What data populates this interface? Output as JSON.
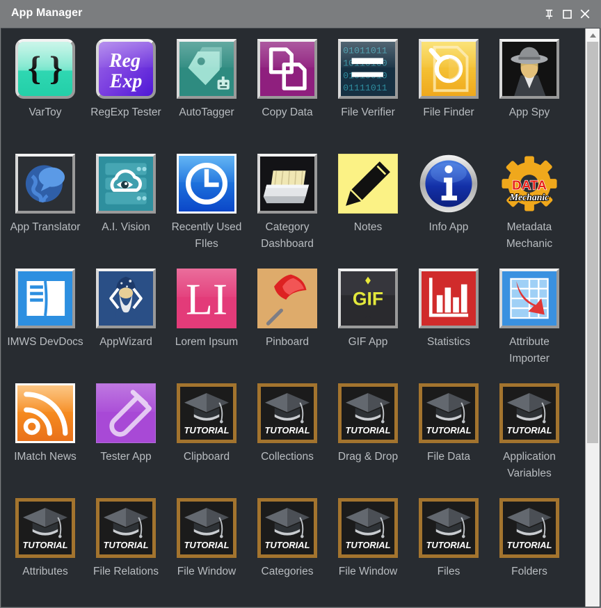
{
  "window": {
    "title": "App Manager",
    "titlebar_bg": "#7b7d7f",
    "client_bg": "#282c31",
    "label_color": "#b9bdc1",
    "buttons": [
      {
        "name": "pin-icon",
        "label": "Pin"
      },
      {
        "name": "maximize-icon",
        "label": "Maximize"
      },
      {
        "name": "close-icon",
        "label": "Close"
      }
    ]
  },
  "scrollbar": {
    "up_arrow": "▲",
    "thumb_position_percent": 0,
    "thumb_size_percent": 71
  },
  "apps": [
    {
      "name": "VarToy",
      "icon": "vartoy-icon"
    },
    {
      "name": "RegExp Tester",
      "icon": "regexp-tester-icon"
    },
    {
      "name": "AutoTagger",
      "icon": "autotagger-icon"
    },
    {
      "name": "Copy Data",
      "icon": "copy-data-icon"
    },
    {
      "name": "File Verifier",
      "icon": "file-verifier-icon"
    },
    {
      "name": "File Finder",
      "icon": "file-finder-icon"
    },
    {
      "name": "App Spy",
      "icon": "app-spy-icon"
    },
    {
      "name": "App Translator",
      "icon": "app-translator-icon"
    },
    {
      "name": "A.I. Vision",
      "icon": "ai-vision-icon"
    },
    {
      "name": "Recently Used FIles",
      "icon": "recently-used-files-icon"
    },
    {
      "name": "Category Dashboard",
      "icon": "category-dashboard-icon"
    },
    {
      "name": "Notes",
      "icon": "notes-icon"
    },
    {
      "name": "Info App",
      "icon": "info-app-icon"
    },
    {
      "name": "Metadata Mechanic",
      "icon": "metadata-mechanic-icon"
    },
    {
      "name": "IMWS DevDocs",
      "icon": "imws-devdocs-icon"
    },
    {
      "name": "AppWizard",
      "icon": "appwizard-icon"
    },
    {
      "name": "Lorem Ipsum",
      "icon": "lorem-ipsum-icon"
    },
    {
      "name": "Pinboard",
      "icon": "pinboard-icon"
    },
    {
      "name": "GIF App",
      "icon": "gif-app-icon"
    },
    {
      "name": "Statistics",
      "icon": "statistics-icon"
    },
    {
      "name": "Attribute Importer",
      "icon": "attribute-importer-icon"
    },
    {
      "name": "IMatch News",
      "icon": "imatch-news-icon"
    },
    {
      "name": "Tester App",
      "icon": "tester-app-icon"
    },
    {
      "name": "Clipboard",
      "icon": "tutorial-icon"
    },
    {
      "name": "Collections",
      "icon": "tutorial-icon"
    },
    {
      "name": "Drag & Drop",
      "icon": "tutorial-icon"
    },
    {
      "name": "File Data",
      "icon": "tutorial-icon"
    },
    {
      "name": "Application Variables",
      "icon": "tutorial-icon"
    },
    {
      "name": "Attributes",
      "icon": "tutorial-icon"
    },
    {
      "name": "File Relations",
      "icon": "tutorial-icon"
    },
    {
      "name": "File Window",
      "icon": "tutorial-icon"
    },
    {
      "name": "Categories",
      "icon": "tutorial-icon"
    },
    {
      "name": "File Window",
      "icon": "tutorial-icon"
    },
    {
      "name": "Files",
      "icon": "tutorial-icon"
    },
    {
      "name": "Folders",
      "icon": "tutorial-icon"
    }
  ],
  "icon_texts": {
    "regexp_line1": "Reg",
    "regexp_line2": "Exp",
    "file_verifier_bits": [
      "01011011",
      "10110100",
      "01010010",
      "01111011"
    ],
    "lorem_ipsum": "LI",
    "gif": "GIF",
    "metadata_top": "DATA",
    "metadata_bottom": "Mechanic",
    "tutorial": "TUTORIAL"
  }
}
